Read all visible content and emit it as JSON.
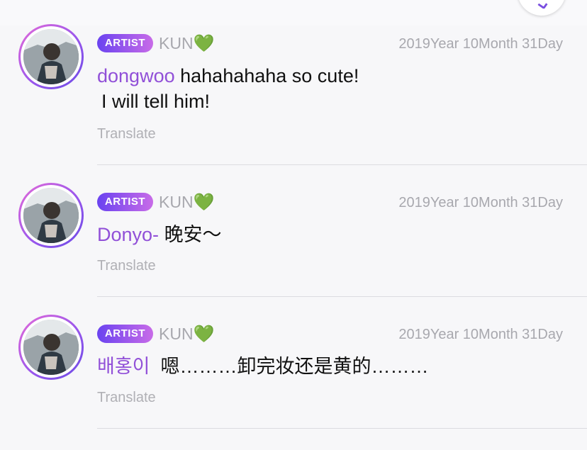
{
  "comments": [
    {
      "badge": "ARTIST",
      "artist": "KUN",
      "heart": "💚",
      "date": "2019Year 10Month 31Day",
      "username": "dongwoo",
      "message": "hahahahaha so cute!",
      "message_line2": "I will tell him!",
      "translate": "Translate"
    },
    {
      "badge": "ARTIST",
      "artist": "KUN",
      "heart": "💚",
      "date": "2019Year 10Month 31Day",
      "username": "Donyo-",
      "message": "晚安～",
      "translate": "Translate"
    },
    {
      "badge": "ARTIST",
      "artist": "KUN",
      "heart": "💚",
      "date": "2019Year 10Month 31Day",
      "username": "배홍이",
      "message": "嗯………卸完妆还是黄的………",
      "translate": "Translate"
    }
  ],
  "colors": {
    "accent": "#9150d8",
    "badge_start": "#6a43f0",
    "badge_end": "#c86be8",
    "heart": "#35c04a",
    "muted_text": "#a8a8ae"
  }
}
